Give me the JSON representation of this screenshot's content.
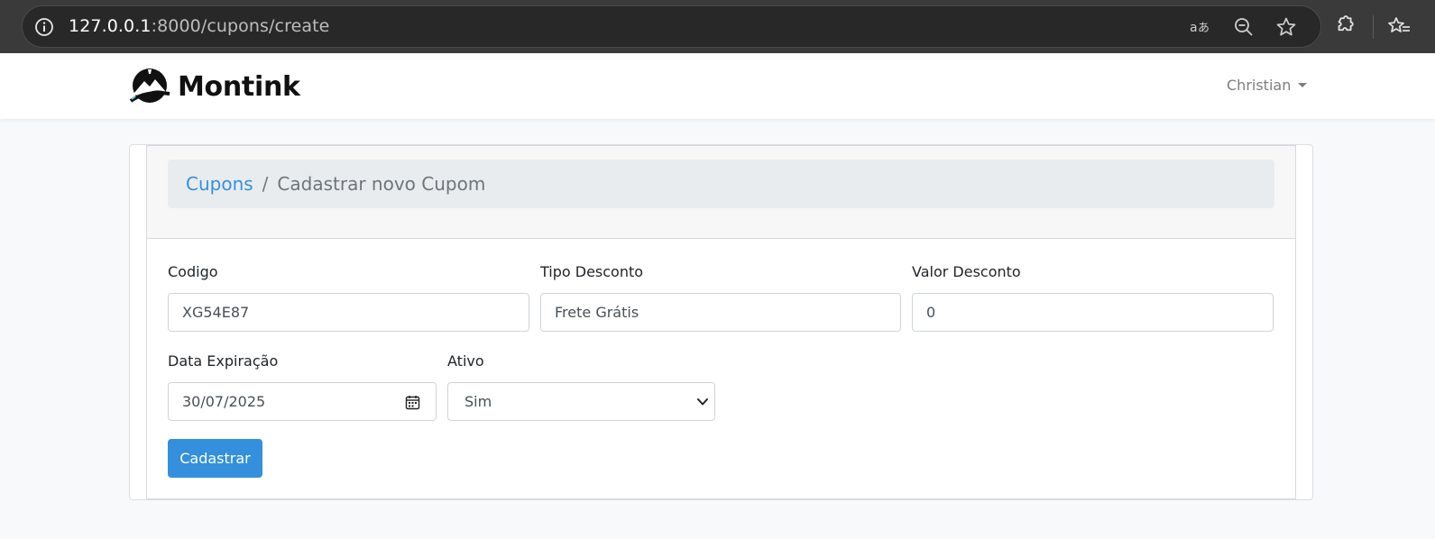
{
  "browser": {
    "url_host": "127.0.0.1",
    "url_rest": ":8000/cupons/create",
    "icons": [
      "site-info-icon",
      "translate-icon",
      "zoom-out-icon",
      "bookmark-star-icon",
      "extensions-icon",
      "reading-list-icon"
    ]
  },
  "navbar": {
    "brand_name": "Montink",
    "user_name": "Christian"
  },
  "breadcrumb": {
    "parent": "Cupons",
    "separator": "/",
    "current": "Cadastrar novo Cupom"
  },
  "form": {
    "codigo": {
      "label": "Codigo",
      "value": "XG54E87"
    },
    "tipo_desconto": {
      "label": "Tipo Desconto",
      "value": "Frete Grátis"
    },
    "valor_desconto": {
      "label": "Valor Desconto",
      "value": "0"
    },
    "data_expiracao": {
      "label": "Data Expiração",
      "value": "30/07/2025"
    },
    "ativo": {
      "label": "Ativo",
      "value": "Sim"
    },
    "submit_label": "Cadastrar"
  },
  "colors": {
    "primary": "#3490dc",
    "chrome_bg": "#3a3a3a",
    "breadcrumb_bg": "#e9ecef"
  }
}
